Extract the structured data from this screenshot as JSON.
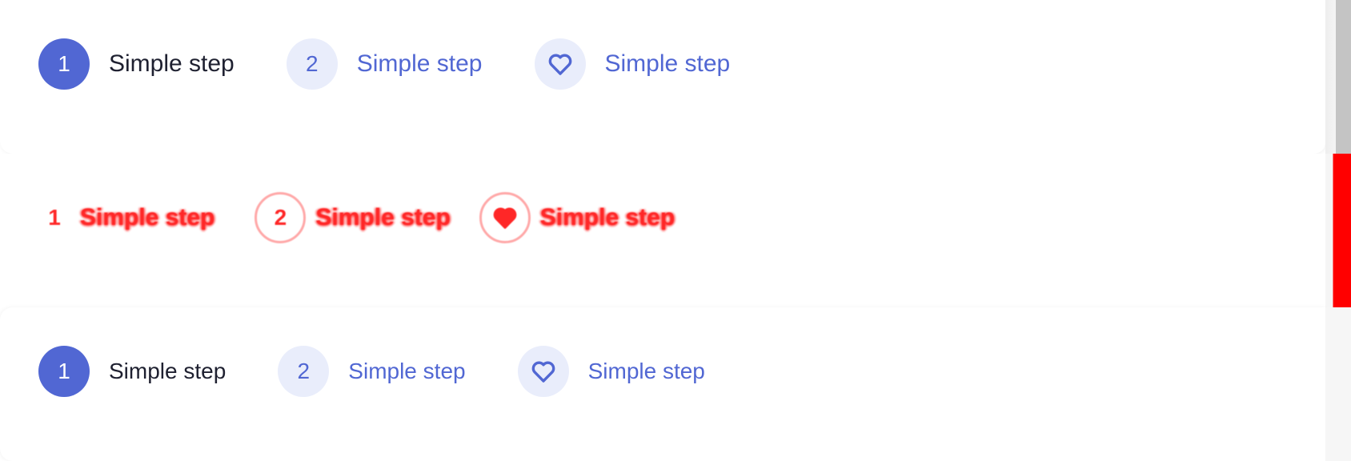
{
  "variants": [
    {
      "id": "top",
      "steps": [
        {
          "number": "1",
          "label": "Simple step",
          "state": "active",
          "icon": ""
        },
        {
          "number": "2",
          "label": "Simple step",
          "state": "idle",
          "icon": ""
        },
        {
          "number": "",
          "label": "Simple step",
          "state": "idle",
          "icon": "heart-icon"
        }
      ]
    },
    {
      "id": "diff",
      "steps": [
        {
          "number": "1",
          "label": "Simple step"
        },
        {
          "number": "2",
          "label": "Simple step"
        },
        {
          "number": "",
          "label": "Simple step",
          "icon": "heart-icon"
        }
      ]
    },
    {
      "id": "bottom",
      "steps": [
        {
          "number": "1",
          "label": "Simple step",
          "state": "active",
          "icon": ""
        },
        {
          "number": "2",
          "label": "Simple step",
          "state": "idle",
          "icon": ""
        },
        {
          "number": "",
          "label": "Simple step",
          "state": "idle",
          "icon": "heart-icon"
        }
      ]
    }
  ],
  "colors": {
    "accent": "#5167d3",
    "accent_light": "#e9edfb",
    "text_dark": "#1e2030",
    "diff_red": "#ff0000",
    "scrollbar_gray": "#c4c4c4"
  }
}
